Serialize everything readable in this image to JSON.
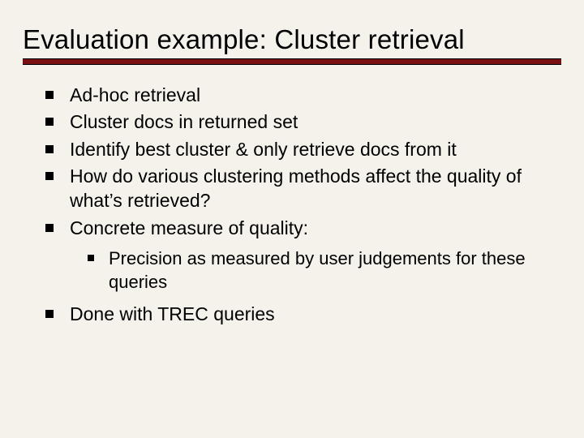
{
  "title": "Evaluation example: Cluster retrieval",
  "bullets": {
    "b0": "Ad-hoc retrieval",
    "b1": "Cluster docs in returned set",
    "b2": "Identify best cluster & only retrieve docs from it",
    "b3": "How do various clustering methods affect the quality of what’s retrieved?",
    "b4": "Concrete measure of quality:",
    "b4_sub0": "Precision as measured by user judgements for these queries",
    "b5": "Done with TREC queries"
  }
}
